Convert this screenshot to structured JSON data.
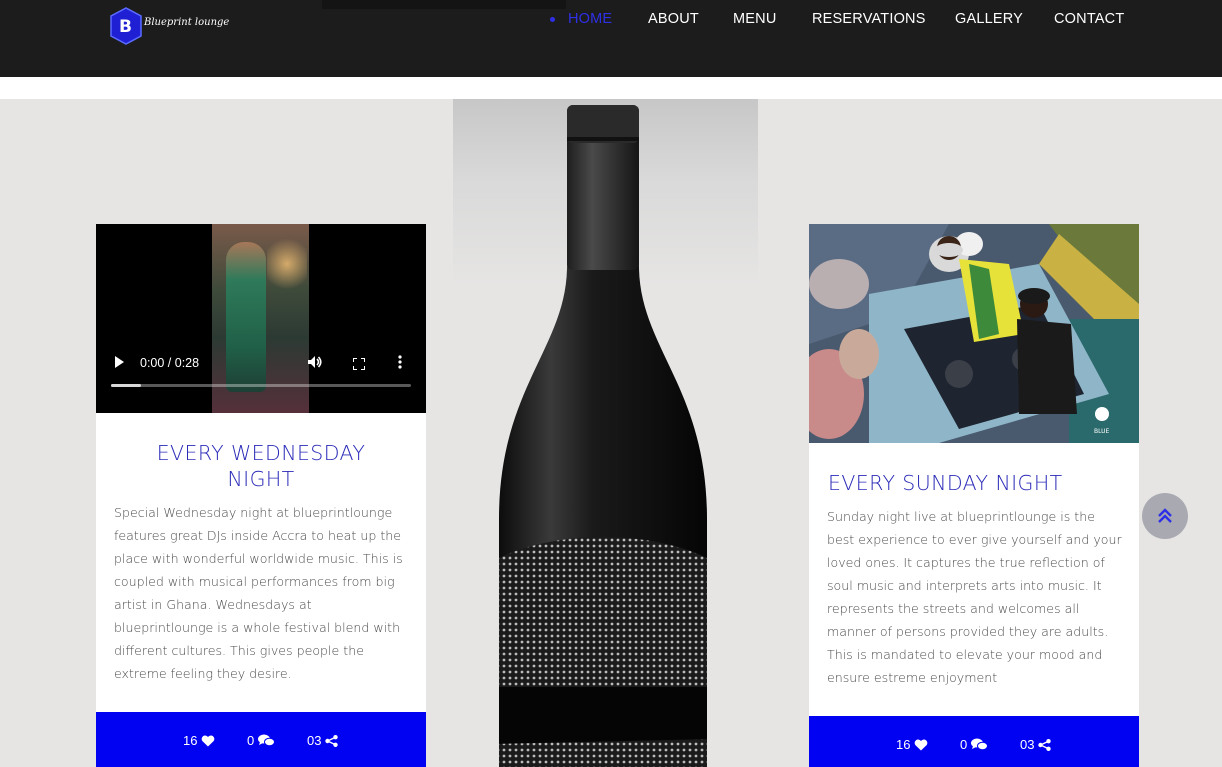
{
  "brand": {
    "logo_text": "Blueprint lounge",
    "logo_letter": "B",
    "accent_color": "#0202f2",
    "nav_text_color": "#ffffff",
    "active_color": "#2f2fe8"
  },
  "nav": {
    "items": [
      {
        "label": "HOME",
        "active": true
      },
      {
        "label": "ABOUT",
        "active": false
      },
      {
        "label": "MENU",
        "active": false
      },
      {
        "label": "RESERVATIONS",
        "active": false
      },
      {
        "label": "GALLERY",
        "active": false
      },
      {
        "label": "CONTACT",
        "active": false
      }
    ]
  },
  "events": [
    {
      "media": "video",
      "video_time": "0:00 / 0:28",
      "video_progress": 0.1,
      "title": "EVERY WEDNESDAY NIGHT",
      "body": "Special Wednesday night at blueprintlounge features great DJs inside Accra to heat up the place with wonderful worldwide music. This is coupled with musical performances from big artist in Ghana. Wednesdays at blueprintlounge is a whole festival blend with different cultures. This gives people the extreme feeling they desire.",
      "likes": "16",
      "comments": "0",
      "shares": "03"
    },
    {
      "media": "image",
      "image_watermark": "BLUE",
      "title": "EVERY SUNDAY NIGHT",
      "body": "Sunday night live at blueprintlounge is the best experience to ever give yourself and your loved ones. It captures the true reflection of soul music and interprets arts into music. It represents the streets and welcomes all manner of persons provided they are adults. This is mandated to elevate your mood and ensure estreme enjoyment",
      "likes": "16",
      "comments": "0",
      "shares": "03"
    }
  ],
  "icons": {
    "like": "heart-icon",
    "comment": "comments-icon",
    "share": "share-icon",
    "scroll_top": "chevron-up-icon",
    "play": "play-icon",
    "volume": "volume-icon",
    "fullscreen": "fullscreen-icon",
    "more": "more-vertical-icon"
  }
}
